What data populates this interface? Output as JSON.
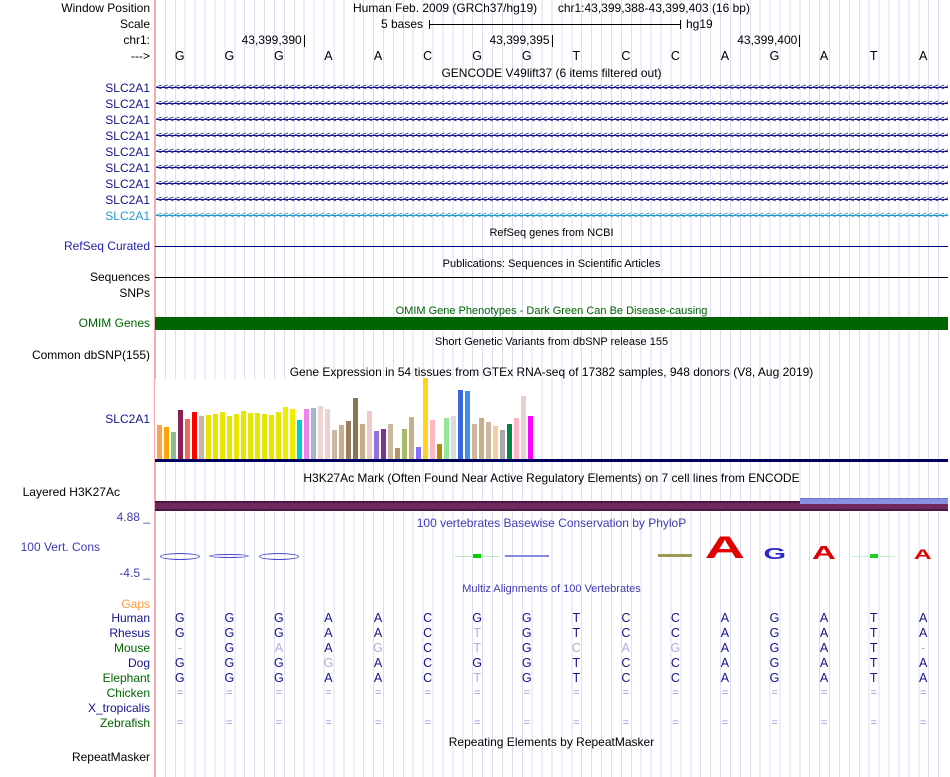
{
  "header": {
    "window_position_label": "Window Position",
    "assembly": "Human Feb. 2009 (GRCh37/hg19)",
    "position": "chr1:43,399,388-43,399,403 (16 bp)",
    "scale_label": "Scale",
    "scale_value": "5 bases",
    "scale_tag": "hg19",
    "chrom_label": "chr1:",
    "coords": [
      {
        "label": "43,399,390",
        "tick_base": 3
      },
      {
        "label": "43,399,395",
        "tick_base": 8
      },
      {
        "label": "43,399,400",
        "tick_base": 13
      }
    ],
    "strand_label": "--->",
    "sequence": [
      "G",
      "G",
      "G",
      "A",
      "A",
      "C",
      "G",
      "G",
      "T",
      "C",
      "C",
      "A",
      "G",
      "A",
      "T",
      "A"
    ]
  },
  "gencode": {
    "title": "GENCODE V49lift37 (6 items filtered out)",
    "transcripts": [
      {
        "label": "SLC2A1",
        "color": "#14148C"
      },
      {
        "label": "SLC2A1",
        "color": "#14148C"
      },
      {
        "label": "SLC2A1",
        "color": "#14148C"
      },
      {
        "label": "SLC2A1",
        "color": "#14148C"
      },
      {
        "label": "SLC2A1",
        "color": "#14148C"
      },
      {
        "label": "SLC2A1",
        "color": "#14148C"
      },
      {
        "label": "SLC2A1",
        "color": "#14148C"
      },
      {
        "label": "SLC2A1",
        "color": "#14148C"
      },
      {
        "label": "SLC2A1",
        "color": "#2299CC"
      }
    ]
  },
  "refseq": {
    "title": "RefSeq genes from NCBI",
    "label": "RefSeq Curated",
    "line_color": "#000080"
  },
  "publications": {
    "title": "Publications: Sequences in Scientific Articles",
    "label": "Sequences",
    "line_color": "#000000"
  },
  "snps_label": "SNPs",
  "omim": {
    "title": "OMIM Gene Phenotypes - Dark Green Can Be Disease-causing",
    "label": "OMIM Genes",
    "bar_color": "#006400"
  },
  "dbsnp": {
    "title": "Short Genetic Variants from dbSNP release 155",
    "label": "Common dbSNP(155)"
  },
  "gtex": {
    "title": "Gene Expression in 54 tissues from GTEx RNA-seq of 17382 samples, 948 donors (V8, Aug 2019)",
    "label": "SLC2A1"
  },
  "chart_data": {
    "type": "bar",
    "title": "Gene Expression in 54 tissues from GTEx RNA-seq of 17382 samples, 948 donors (V8, Aug 2019)",
    "gene": "SLC2A1",
    "x_tick_labels_visible": false,
    "note": "54 tissue bars, GTEx tissue color convention; values are relative bar heights in pixels (max 82), no numeric axis shown in image",
    "ylim": [
      0,
      82
    ],
    "bars": [
      {
        "color": "#FFA054",
        "value": 35
      },
      {
        "color": "#FFA500",
        "value": 33
      },
      {
        "color": "#8FBC8F",
        "value": 28
      },
      {
        "color": "#8B2252",
        "value": 50
      },
      {
        "color": "#EE6A50",
        "value": 41
      },
      {
        "color": "#FF0000",
        "value": 48
      },
      {
        "color": "#CDB79E",
        "value": 44
      },
      {
        "color": "#E6E600",
        "value": 45
      },
      {
        "color": "#E6E600",
        "value": 46
      },
      {
        "color": "#E6E600",
        "value": 48
      },
      {
        "color": "#E6E600",
        "value": 44
      },
      {
        "color": "#E6E600",
        "value": 46
      },
      {
        "color": "#E6E600",
        "value": 49
      },
      {
        "color": "#E6E600",
        "value": 47
      },
      {
        "color": "#E6E600",
        "value": 47
      },
      {
        "color": "#E6E600",
        "value": 46
      },
      {
        "color": "#E6E600",
        "value": 45
      },
      {
        "color": "#E6E600",
        "value": 48
      },
      {
        "color": "#EEEE00",
        "value": 53
      },
      {
        "color": "#EEEE00",
        "value": 51
      },
      {
        "color": "#00CED1",
        "value": 40
      },
      {
        "color": "#EE82EE",
        "value": 51
      },
      {
        "color": "#9FB6CD",
        "value": 52
      },
      {
        "color": "#EED5D2",
        "value": 54
      },
      {
        "color": "#EDD0D0",
        "value": 51
      },
      {
        "color": "#CDB79E",
        "value": 30
      },
      {
        "color": "#C9AE8C",
        "value": 35
      },
      {
        "color": "#9B7E5E",
        "value": 39
      },
      {
        "color": "#8B7355",
        "value": 62
      },
      {
        "color": "#CDAA7D",
        "value": 36
      },
      {
        "color": "#EFCACA",
        "value": 49
      },
      {
        "color": "#9370DB",
        "value": 29
      },
      {
        "color": "#7A378B",
        "value": 31
      },
      {
        "color": "#CDB79E",
        "value": 36
      },
      {
        "color": "#B8916B",
        "value": 12
      },
      {
        "color": "#AABB66",
        "value": 31
      },
      {
        "color": "#C9AE8C",
        "value": 43
      },
      {
        "color": "#8470FF",
        "value": 13
      },
      {
        "color": "#FFD320",
        "value": 82
      },
      {
        "color": "#FFB6C1",
        "value": 40
      },
      {
        "color": "#B8860B",
        "value": 16
      },
      {
        "color": "#98E698",
        "value": 42
      },
      {
        "color": "#D8DDE0",
        "value": 44
      },
      {
        "color": "#3A66DE",
        "value": 70
      },
      {
        "color": "#3E8EF0",
        "value": 69
      },
      {
        "color": "#CDB79E",
        "value": 36
      },
      {
        "color": "#C9AE8C",
        "value": 42
      },
      {
        "color": "#CDB79E",
        "value": 38
      },
      {
        "color": "#F5CD9E",
        "value": 34
      },
      {
        "color": "#A9A9A9",
        "value": 30
      },
      {
        "color": "#038549",
        "value": 36
      },
      {
        "color": "#FFB6C1",
        "value": 42
      },
      {
        "color": "#E8D0CC",
        "value": 64
      },
      {
        "color": "#FF00FF",
        "value": 44
      }
    ]
  },
  "h3k27ac": {
    "title": "H3K27Ac Mark (Often Found Near Active Regulatory Elements) on 7 cell lines from ENCODE",
    "label": "Layered H3K27Ac",
    "bar_color": "#6E2A60",
    "overlay_color": "#8890E2"
  },
  "conservation": {
    "scale_max": "4.88 _",
    "scale_min": "-4.5 _",
    "title": "100 vertebrates Basewise Conservation by PhyloP",
    "label": "100 Vert. Cons",
    "glyphs": [
      {
        "base": 1,
        "kind": "lens",
        "h": 7
      },
      {
        "base": 2,
        "kind": "lens",
        "h": 4
      },
      {
        "base": 3,
        "kind": "lens",
        "h": 7
      },
      {
        "base": 7,
        "kind": "dotline",
        "line": "#BBE8BB",
        "dot": "#00CC00"
      },
      {
        "base": 8,
        "kind": "hline",
        "color": "#8888DD",
        "h": 2
      },
      {
        "base": 11,
        "kind": "dash",
        "color": "#9A9A52",
        "h": 3
      },
      {
        "base": 12,
        "kind": "letter",
        "char": "A",
        "color": "#E00000",
        "h": 27
      },
      {
        "base": 13,
        "kind": "letter",
        "char": "G",
        "color": "#2828C8",
        "h": 14
      },
      {
        "base": 14,
        "kind": "letter",
        "char": "A",
        "color": "#E00000",
        "h": 16
      },
      {
        "base": 15,
        "kind": "dotline",
        "line": "#C8EEC8",
        "dot": "#22CC22"
      },
      {
        "base": 16,
        "kind": "letter",
        "char": "A",
        "color": "#E00000",
        "h": 12
      }
    ]
  },
  "multiz": {
    "title": "Multiz Alignments of 100 Vertebrates",
    "gaps_label": "Gaps",
    "rows": [
      {
        "label": "Human",
        "color": "#14148C",
        "cells": [
          "G",
          "G",
          "G",
          "A",
          "A",
          "C",
          "G",
          "G",
          "T",
          "C",
          "C",
          "A",
          "G",
          "A",
          "T",
          "A"
        ]
      },
      {
        "label": "Rhesus",
        "color": "#14148C",
        "cells": [
          "G",
          "G",
          "G",
          "A",
          "A",
          "C",
          "T*",
          "G",
          "T",
          "C",
          "C",
          "A",
          "G",
          "A",
          "T",
          "A"
        ]
      },
      {
        "label": "Mouse",
        "color": "#006400",
        "cells": [
          "-*",
          "G",
          "A*",
          "A",
          "G*",
          "C",
          "T*",
          "G",
          "C*",
          "A*",
          "G*",
          "A",
          "G",
          "A",
          "T",
          "-*"
        ]
      },
      {
        "label": "Dog",
        "color": "#14148C",
        "cells": [
          "G",
          "G",
          "G",
          "G*",
          "A",
          "C",
          "G",
          "G",
          "T",
          "C",
          "C",
          "A",
          "G",
          "A",
          "T",
          "A"
        ]
      },
      {
        "label": "Elephant",
        "color": "#006400",
        "cells": [
          "G",
          "G",
          "G",
          "A",
          "A",
          "C",
          "T*",
          "G",
          "T",
          "C",
          "C",
          "A",
          "G",
          "A",
          "T",
          "A"
        ]
      },
      {
        "label": "Chicken",
        "color": "#006400",
        "cells": [
          "=",
          "=",
          "=",
          "=",
          "=",
          "=",
          "=",
          "=",
          "=",
          "=",
          "=",
          "=",
          "=",
          "=",
          "=",
          "="
        ]
      },
      {
        "label": "X_tropicalis",
        "color": "#14148C",
        "cells": [
          "",
          "",
          "",
          "",
          "",
          "",
          "",
          "",
          "",
          "",
          "",
          "",
          "",
          "",
          "",
          ""
        ]
      },
      {
        "label": "Zebrafish",
        "color": "#006400",
        "cells": [
          "=",
          "=",
          "=",
          "=",
          "=",
          "=",
          "=",
          "=",
          "=",
          "=",
          "=",
          "=",
          "=",
          "=",
          "=",
          "="
        ]
      }
    ]
  },
  "repeatmasker": {
    "title": "Repeating Elements by RepeatMasker",
    "label": "RepeatMasker"
  },
  "colors": {
    "grid": "#DCDCF4",
    "guide": "#FBAAAA",
    "navy": "#14148C",
    "title_blue": "#3B3BB4",
    "omim_green": "#006400"
  }
}
